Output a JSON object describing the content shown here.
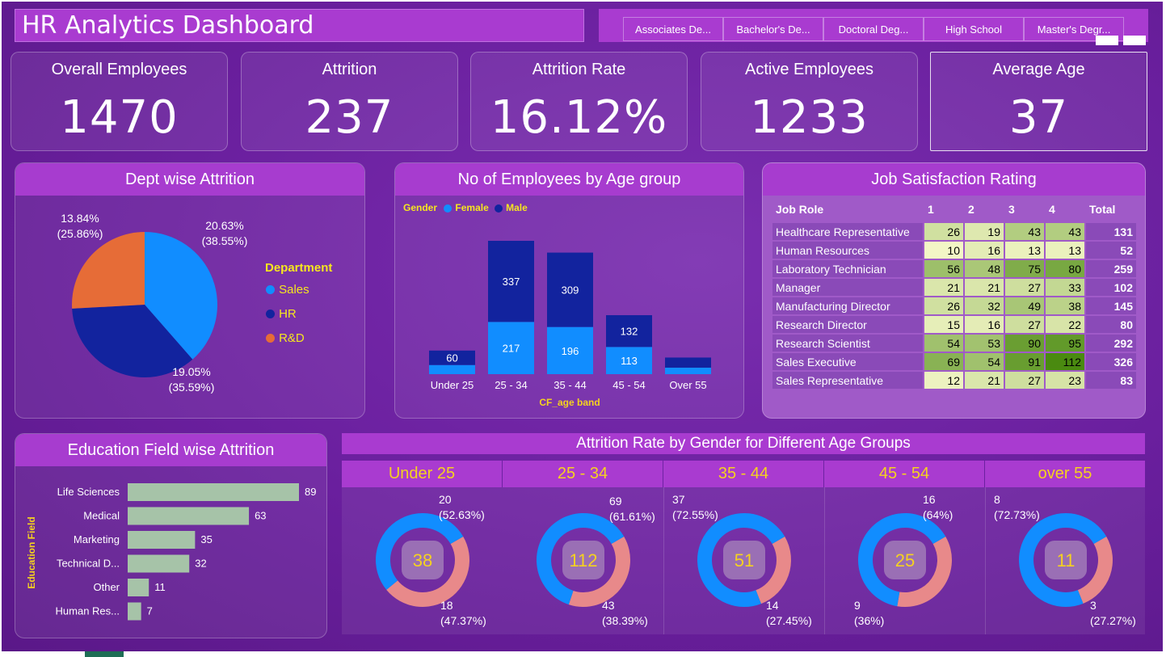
{
  "header": {
    "title": "HR Analytics Dashboard"
  },
  "education_slicer": {
    "items": [
      "Associates De...",
      "Bachelor's De...",
      "Doctoral Deg...",
      "High School",
      "Master's Degr..."
    ]
  },
  "kpis": [
    {
      "label": "Overall Employees",
      "value": "1470"
    },
    {
      "label": "Attrition",
      "value": "237"
    },
    {
      "label": "Attrition Rate",
      "value": "16.12%"
    },
    {
      "label": "Active Employees",
      "value": "1233"
    },
    {
      "label": "Average Age",
      "value": "37"
    }
  ],
  "dept_attrition": {
    "title": "Dept wise Attrition",
    "legend_title": "Department",
    "colors": {
      "Sales": "#118dff",
      "HR": "#12239e",
      "R&D": "#e66c37"
    },
    "chart_data": {
      "type": "pie",
      "title": "Dept wise Attrition",
      "categories": [
        "Sales",
        "HR",
        "R&D"
      ],
      "values": [
        38.55,
        35.59,
        25.86
      ],
      "labels": [
        [
          "20.63%",
          "(38.55%)"
        ],
        [
          "19.05%",
          "(35.59%)"
        ],
        [
          "13.84%",
          "(25.86%)"
        ]
      ],
      "legend_placement": "right"
    }
  },
  "age_group_chart": {
    "title": "No of Employees by Age group",
    "legend_title": "Gender",
    "x_label": "CF_age band",
    "colors": {
      "Female": "#118dff",
      "Male": "#12239e"
    },
    "chart_data": {
      "type": "bar",
      "stacked": true,
      "title": "No of Employees by Age group",
      "xlabel": "CF_age band",
      "categories": [
        "Under 25",
        "25 - 34",
        "35 - 44",
        "45 - 54",
        "Over 55"
      ],
      "series": [
        {
          "name": "Female",
          "values": [
            38,
            217,
            196,
            113,
            27
          ]
        },
        {
          "name": "Male",
          "values": [
            60,
            337,
            309,
            132,
            42
          ]
        }
      ],
      "value_labels": {
        "Female": [
          "",
          "217",
          "196",
          "113",
          ""
        ],
        "Male": [
          "60",
          "337",
          "309",
          "132",
          ""
        ]
      },
      "legend_placement": "top-left"
    }
  },
  "job_satisfaction": {
    "title": "Job Satisfaction Rating",
    "columns": [
      "Job Role",
      "1",
      "2",
      "3",
      "4",
      "Total"
    ],
    "rows": [
      {
        "role": "Healthcare Representative",
        "r1": "26",
        "r2": "19",
        "r3": "43",
        "r4": "43",
        "total": "131"
      },
      {
        "role": "Human Resources",
        "r1": "10",
        "r2": "16",
        "r3": "13",
        "r4": "13",
        "total": "52"
      },
      {
        "role": "Laboratory Technician",
        "r1": "56",
        "r2": "48",
        "r3": "75",
        "r4": "80",
        "total": "259"
      },
      {
        "role": "Manager",
        "r1": "21",
        "r2": "21",
        "r3": "27",
        "r4": "33",
        "total": "102"
      },
      {
        "role": "Manufacturing Director",
        "r1": "26",
        "r2": "32",
        "r3": "49",
        "r4": "38",
        "total": "145"
      },
      {
        "role": "Research Director",
        "r1": "15",
        "r2": "16",
        "r3": "27",
        "r4": "22",
        "total": "80"
      },
      {
        "role": "Research Scientist",
        "r1": "54",
        "r2": "53",
        "r3": "90",
        "r4": "95",
        "total": "292"
      },
      {
        "role": "Sales Executive",
        "r1": "69",
        "r2": "54",
        "r3": "91",
        "r4": "112",
        "total": "326"
      },
      {
        "role": "Sales Representative",
        "r1": "12",
        "r2": "21",
        "r3": "27",
        "r4": "23",
        "total": "83"
      }
    ],
    "heat_colors": {
      "low": "#f3f6c6",
      "high": "#4a8a10"
    }
  },
  "education_attrition": {
    "title": "Education Field wise Attrition",
    "axis_label": "Education Field",
    "bar_color": "#a6c3a8",
    "chart_data": {
      "type": "bar",
      "orientation": "horizontal",
      "title": "Education Field wise Attrition",
      "ylabel": "Education Field",
      "categories": [
        "Life Sciences",
        "Medical",
        "Marketing",
        "Technical D...",
        "Other",
        "Human Res..."
      ],
      "values": [
        89,
        63,
        35,
        32,
        11,
        7
      ],
      "xlim": [
        0,
        89
      ]
    }
  },
  "gender_age_attrition": {
    "title": "Attrition Rate by Gender for Different Age Groups",
    "colors": {
      "first": "#118dff",
      "second": "#e8898a",
      "center": "#9a6fb5",
      "center_text": "#f5d21f"
    },
    "chart_data": [
      {
        "type": "pie",
        "title": "Under 25",
        "total": "38",
        "values": [
          20,
          18
        ],
        "top_label": [
          "20",
          "(52.63%)"
        ],
        "bottom_label": [
          "18",
          "(47.37%)"
        ]
      },
      {
        "type": "pie",
        "title": "25 - 34",
        "total": "112",
        "values": [
          69,
          43
        ],
        "top_label": [
          "69",
          "(61.61%)"
        ],
        "bottom_label": [
          "43",
          "(38.39%)"
        ]
      },
      {
        "type": "pie",
        "title": "35 - 44",
        "total": "51",
        "values": [
          37,
          14
        ],
        "top_label": [
          "37",
          "(72.55%)"
        ],
        "bottom_label": [
          "14",
          "(27.45%)"
        ]
      },
      {
        "type": "pie",
        "title": "45 - 54",
        "total": "25",
        "values": [
          16,
          9
        ],
        "top_label": [
          "16",
          "(64%)"
        ],
        "bottom_label": [
          "9",
          "(36%)"
        ]
      },
      {
        "type": "pie",
        "title": "over 55",
        "total": "11",
        "values": [
          8,
          3
        ],
        "top_label": [
          "8",
          "(72.73%)"
        ],
        "bottom_label": [
          "3",
          "(27.27%)"
        ]
      }
    ]
  }
}
